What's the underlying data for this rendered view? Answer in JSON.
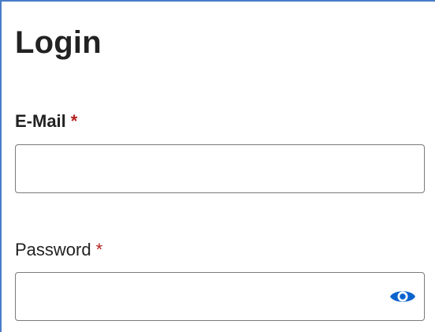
{
  "form": {
    "title": "Login",
    "email": {
      "label": "E-Mail",
      "required_marker": "*",
      "value": "",
      "placeholder": ""
    },
    "password": {
      "label": "Password",
      "required_marker": "*",
      "value": "",
      "placeholder": "",
      "toggle_icon": "eye-icon"
    }
  },
  "colors": {
    "frame_border": "#4a7bc8",
    "required": "#b42020",
    "icon": "#0b63ce"
  }
}
